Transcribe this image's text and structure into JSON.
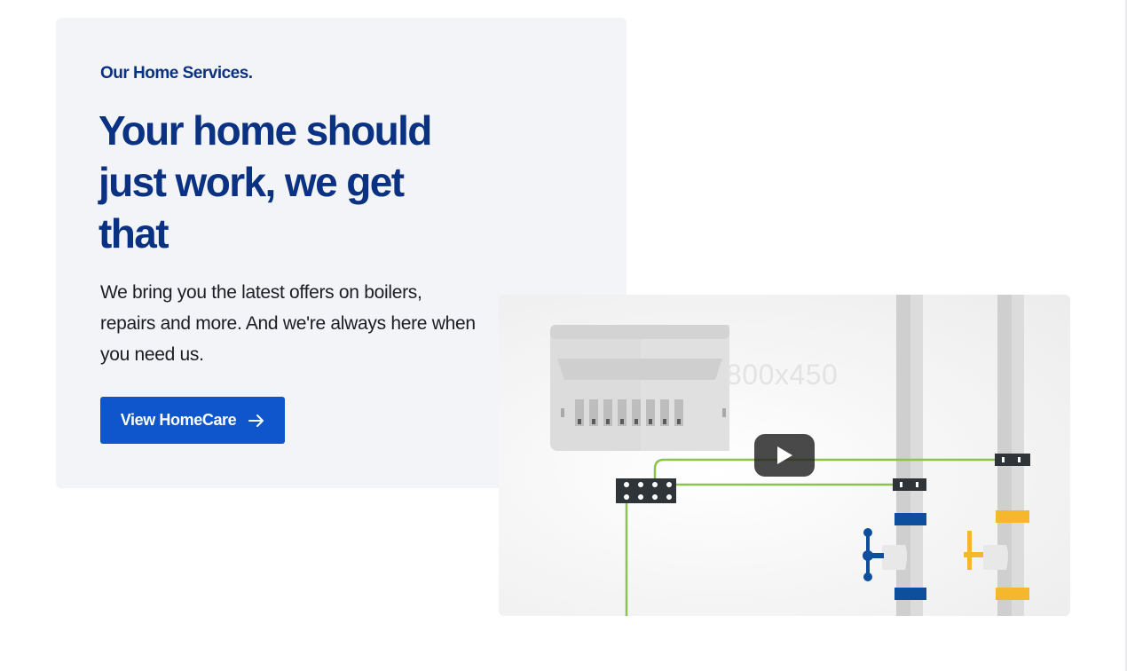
{
  "section": {
    "eyebrow": "Our Home Services.",
    "headline": "Your home should just work, we get that",
    "body": "We bring you the latest offers on boilers, repairs and more. And we're always here when you need us.",
    "cta_label": "View HomeCare"
  },
  "video": {
    "placeholder_text": "800x450",
    "play_icon": "play-icon"
  },
  "colors": {
    "headline": "#0a3182",
    "card_bg": "#f2f4f7",
    "cta_bg": "#0f55cc",
    "wire_green": "#8cc34a",
    "valve_blue": "#0d4f9c",
    "valve_yellow": "#f5b72b"
  }
}
